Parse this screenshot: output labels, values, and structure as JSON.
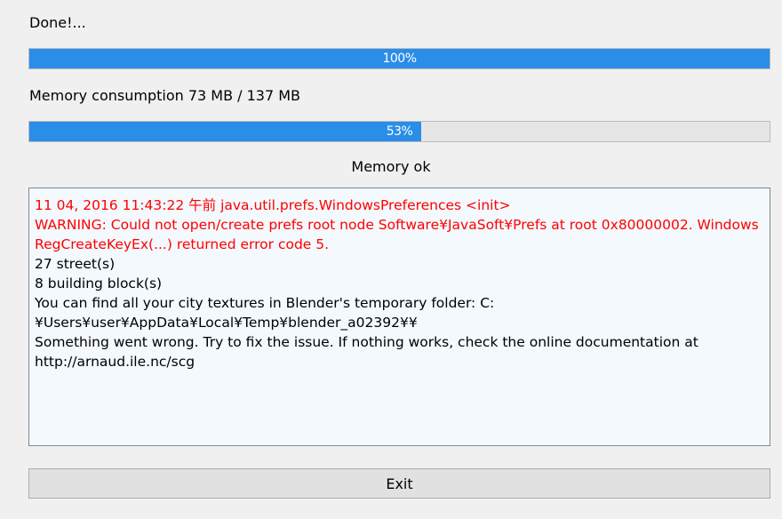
{
  "status": {
    "label": "Done!...",
    "progress_percent": 100,
    "progress_text": "100%"
  },
  "memory": {
    "label": "Memory consumption 73 MB / 137 MB",
    "progress_percent": 53,
    "progress_text": "53%",
    "status_text": "Memory ok"
  },
  "log": {
    "lines": [
      {
        "text": "11 04, 2016 11:43:22 午前 java.util.prefs.WindowsPreferences <init>",
        "level": "error"
      },
      {
        "text": "WARNING: Could not open/create prefs root node Software¥JavaSoft¥Prefs at root 0x80000002. Windows RegCreateKeyEx(...) returned error code 5.",
        "level": "error"
      },
      {
        "text": "27 street(s)",
        "level": "info"
      },
      {
        "text": "8 building block(s)",
        "level": "info"
      },
      {
        "text": "You can find all your city textures in Blender's temporary folder: C:¥Users¥user¥AppData¥Local¥Temp¥blender_a02392¥¥",
        "level": "info"
      },
      {
        "text": "Something went wrong. Try to fix the issue. If nothing works, check the online documentation at http://arnaud.ile.nc/scg",
        "level": "info"
      }
    ]
  },
  "exit_button": {
    "label": "Exit"
  },
  "colors": {
    "progress_fill": "#2a8de8",
    "error_text": "#ff0000",
    "log_background": "#f3f9fd"
  }
}
